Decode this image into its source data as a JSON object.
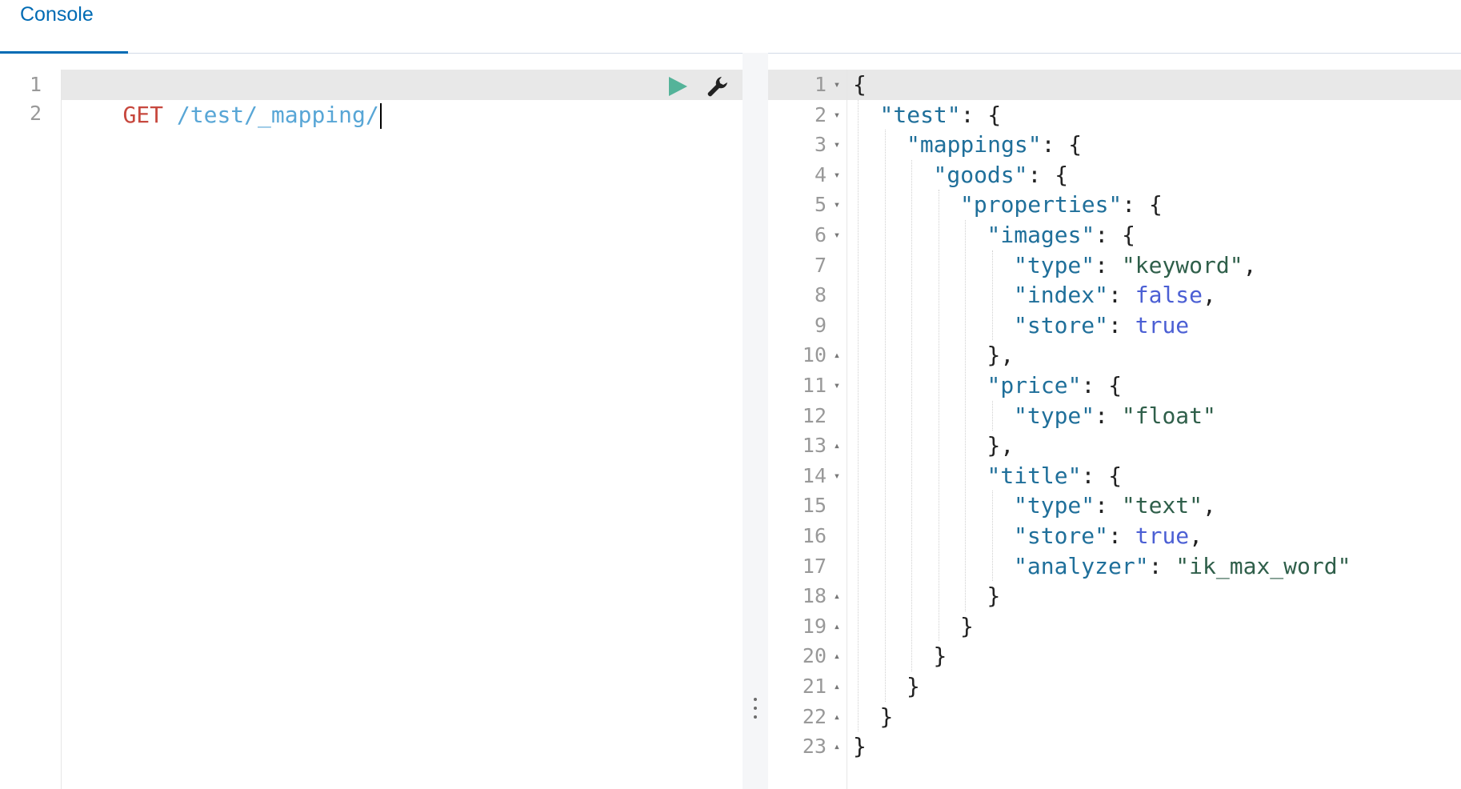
{
  "tabs": [
    {
      "label": "Console",
      "active": true
    }
  ],
  "request": {
    "line_numbers": [
      "1",
      "2"
    ],
    "method": "GET",
    "url": " /test/_mapping/"
  },
  "response": {
    "lines": [
      {
        "n": "1",
        "fold": "▾",
        "indent": 0,
        "parts": [
          {
            "t": "{",
            "c": "plain"
          }
        ]
      },
      {
        "n": "2",
        "fold": "▾",
        "indent": 1,
        "parts": [
          {
            "t": "\"test\"",
            "c": "key"
          },
          {
            "t": ": {",
            "c": "plain"
          }
        ]
      },
      {
        "n": "3",
        "fold": "▾",
        "indent": 2,
        "parts": [
          {
            "t": "\"mappings\"",
            "c": "key"
          },
          {
            "t": ": {",
            "c": "plain"
          }
        ]
      },
      {
        "n": "4",
        "fold": "▾",
        "indent": 3,
        "parts": [
          {
            "t": "\"goods\"",
            "c": "key"
          },
          {
            "t": ": {",
            "c": "plain"
          }
        ]
      },
      {
        "n": "5",
        "fold": "▾",
        "indent": 4,
        "parts": [
          {
            "t": "\"properties\"",
            "c": "key"
          },
          {
            "t": ": {",
            "c": "plain"
          }
        ]
      },
      {
        "n": "6",
        "fold": "▾",
        "indent": 5,
        "parts": [
          {
            "t": "\"images\"",
            "c": "key"
          },
          {
            "t": ": {",
            "c": "plain"
          }
        ]
      },
      {
        "n": "7",
        "fold": "",
        "indent": 6,
        "parts": [
          {
            "t": "\"type\"",
            "c": "key"
          },
          {
            "t": ": ",
            "c": "plain"
          },
          {
            "t": "\"keyword\"",
            "c": "str"
          },
          {
            "t": ",",
            "c": "plain"
          }
        ]
      },
      {
        "n": "8",
        "fold": "",
        "indent": 6,
        "parts": [
          {
            "t": "\"index\"",
            "c": "key"
          },
          {
            "t": ": ",
            "c": "plain"
          },
          {
            "t": "false",
            "c": "bool"
          },
          {
            "t": ",",
            "c": "plain"
          }
        ]
      },
      {
        "n": "9",
        "fold": "",
        "indent": 6,
        "parts": [
          {
            "t": "\"store\"",
            "c": "key"
          },
          {
            "t": ": ",
            "c": "plain"
          },
          {
            "t": "true",
            "c": "bool"
          }
        ]
      },
      {
        "n": "10",
        "fold": "▴",
        "indent": 5,
        "parts": [
          {
            "t": "},",
            "c": "plain"
          }
        ]
      },
      {
        "n": "11",
        "fold": "▾",
        "indent": 5,
        "parts": [
          {
            "t": "\"price\"",
            "c": "key"
          },
          {
            "t": ": {",
            "c": "plain"
          }
        ]
      },
      {
        "n": "12",
        "fold": "",
        "indent": 6,
        "parts": [
          {
            "t": "\"type\"",
            "c": "key"
          },
          {
            "t": ": ",
            "c": "plain"
          },
          {
            "t": "\"float\"",
            "c": "str"
          }
        ]
      },
      {
        "n": "13",
        "fold": "▴",
        "indent": 5,
        "parts": [
          {
            "t": "},",
            "c": "plain"
          }
        ]
      },
      {
        "n": "14",
        "fold": "▾",
        "indent": 5,
        "parts": [
          {
            "t": "\"title\"",
            "c": "key"
          },
          {
            "t": ": {",
            "c": "plain"
          }
        ]
      },
      {
        "n": "15",
        "fold": "",
        "indent": 6,
        "parts": [
          {
            "t": "\"type\"",
            "c": "key"
          },
          {
            "t": ": ",
            "c": "plain"
          },
          {
            "t": "\"text\"",
            "c": "str"
          },
          {
            "t": ",",
            "c": "plain"
          }
        ]
      },
      {
        "n": "16",
        "fold": "",
        "indent": 6,
        "parts": [
          {
            "t": "\"store\"",
            "c": "key"
          },
          {
            "t": ": ",
            "c": "plain"
          },
          {
            "t": "true",
            "c": "bool"
          },
          {
            "t": ",",
            "c": "plain"
          }
        ]
      },
      {
        "n": "17",
        "fold": "",
        "indent": 6,
        "parts": [
          {
            "t": "\"analyzer\"",
            "c": "key"
          },
          {
            "t": ": ",
            "c": "plain"
          },
          {
            "t": "\"ik_max_word\"",
            "c": "str"
          }
        ]
      },
      {
        "n": "18",
        "fold": "▴",
        "indent": 5,
        "parts": [
          {
            "t": "}",
            "c": "plain"
          }
        ]
      },
      {
        "n": "19",
        "fold": "▴",
        "indent": 4,
        "parts": [
          {
            "t": "}",
            "c": "plain"
          }
        ]
      },
      {
        "n": "20",
        "fold": "▴",
        "indent": 3,
        "parts": [
          {
            "t": "}",
            "c": "plain"
          }
        ]
      },
      {
        "n": "21",
        "fold": "▴",
        "indent": 2,
        "parts": [
          {
            "t": "}",
            "c": "plain"
          }
        ]
      },
      {
        "n": "22",
        "fold": "▴",
        "indent": 1,
        "parts": [
          {
            "t": "}",
            "c": "plain"
          }
        ]
      },
      {
        "n": "23",
        "fold": "▴",
        "indent": 0,
        "parts": [
          {
            "t": "}",
            "c": "plain"
          }
        ]
      }
    ]
  },
  "icons": {
    "run": "play-icon",
    "wrench": "wrench-icon",
    "splitter": "vertical-dots-icon"
  },
  "colors": {
    "accent": "#006bb4",
    "method": "#c7483e",
    "url": "#58a6d6",
    "run": "#54b399"
  }
}
